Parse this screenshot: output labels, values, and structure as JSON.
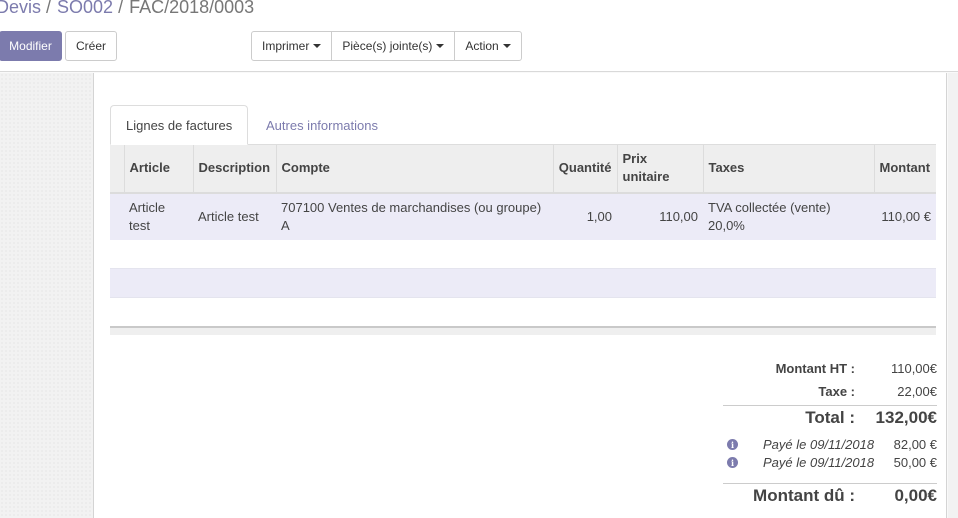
{
  "breadcrumb": {
    "items": [
      "Devis",
      "SO002"
    ],
    "current": "FAC/2018/0003"
  },
  "buttons": {
    "edit": "Modifier",
    "create": "Créer",
    "print": "Imprimer",
    "attachments": "Pièce(s) jointe(s)",
    "action": "Action"
  },
  "tabs": {
    "active": "Lignes de factures",
    "other": "Autres informations"
  },
  "table": {
    "headers": {
      "article": "Article",
      "description": "Description",
      "account": "Compte",
      "quantity": "Quantité",
      "unit_price": "Prix unitaire",
      "taxes": "Taxes",
      "amount": "Montant"
    },
    "rows": [
      {
        "article": "Article test",
        "description": "Article test",
        "account": "707100 Ventes de marchandises (ou groupe) A",
        "quantity": "1,00",
        "unit_price": "110,00",
        "taxes": "TVA collectée (vente) 20,0%",
        "amount": "110,00 €"
      }
    ]
  },
  "totals": {
    "untaxed_label": "Montant HT :",
    "untaxed_value": "110,00€",
    "tax_label": "Taxe :",
    "tax_value": "22,00€",
    "total_label": "Total :",
    "total_value": "132,00€",
    "payments": [
      {
        "label": "Payé le 09/11/2018",
        "amount": "82,00 €"
      },
      {
        "label": "Payé le 09/11/2018",
        "amount": "50,00 €"
      }
    ],
    "due_label": "Montant dû :",
    "due_value": "0,00€"
  },
  "colors": {
    "accent": "#7c7bad",
    "row_highlight": "#ecebf7"
  }
}
